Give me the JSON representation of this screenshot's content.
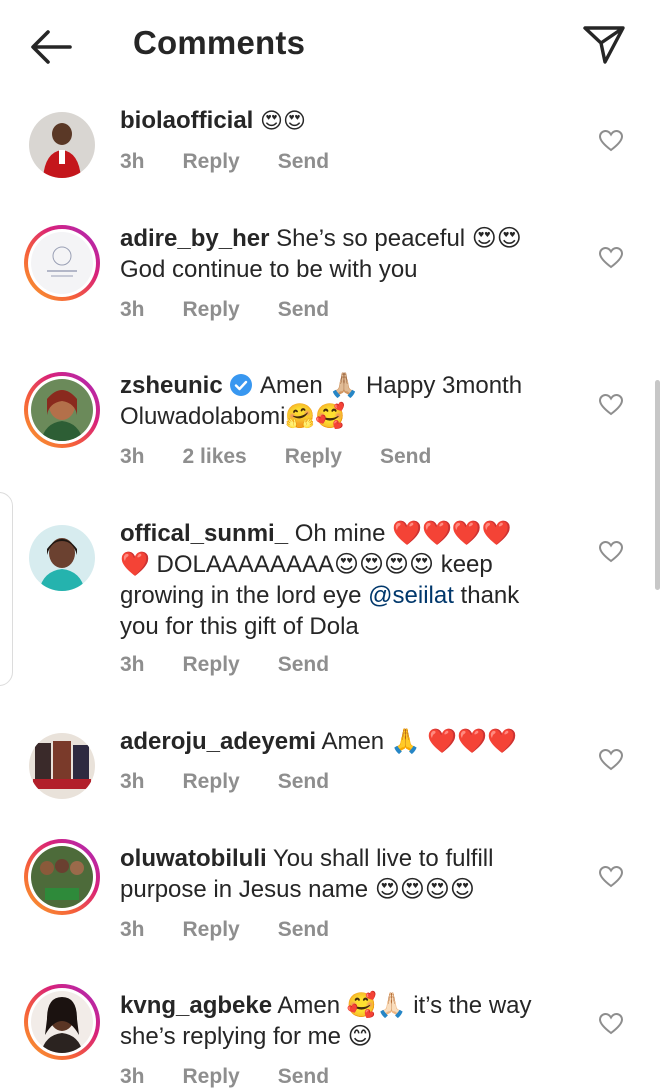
{
  "header": {
    "title": "Comments"
  },
  "comments": [
    {
      "username": "biolaofficial",
      "text": "😍😍",
      "time": "3h",
      "likes": "",
      "reply": "Reply",
      "send": "Send"
    },
    {
      "username": "adire_by_her",
      "text": "She’s so peaceful 😍😍",
      "text2": "God continue to be with you",
      "time": "3h",
      "reply": "Reply",
      "send": "Send"
    },
    {
      "username": "zsheunic",
      "text": "Amen 🙏🏼 Happy 3month",
      "text2": "Oluwadolabomi🤗🥰",
      "time": "3h",
      "likes": "2 likes",
      "reply": "Reply",
      "send": "Send"
    },
    {
      "username": "offical_sunmi_",
      "text": "Oh mine ❤️❤️❤️❤️",
      "text2": "❤️ DOLAAAAAAAA😍😍😍😍 keep",
      "text3a": "growing in the lord eye ",
      "mention": "@seiilat",
      "text3b": "  thank",
      "text4": "you for this gift of Dola",
      "time": "3h",
      "reply": "Reply",
      "send": "Send"
    },
    {
      "username": "aderoju_adeyemi",
      "text": "Amen 🙏 ❤️❤️❤️",
      "time": "3h",
      "reply": "Reply",
      "send": "Send"
    },
    {
      "username": "oluwatobiluli",
      "text": "You shall live to fulfill",
      "text2": "purpose in Jesus name 😍😍😍😍",
      "time": "3h",
      "reply": "Reply",
      "send": "Send"
    },
    {
      "username": "kvng_agbeke",
      "text": "Amen 🥰🙏🏻 it’s the way",
      "text2": "she’s replying for me 😊",
      "time": "3h",
      "reply": "Reply",
      "send": "Send"
    }
  ],
  "colors": {
    "mention": "#00376b",
    "meta": "#8e8e8e",
    "text": "#262626"
  }
}
